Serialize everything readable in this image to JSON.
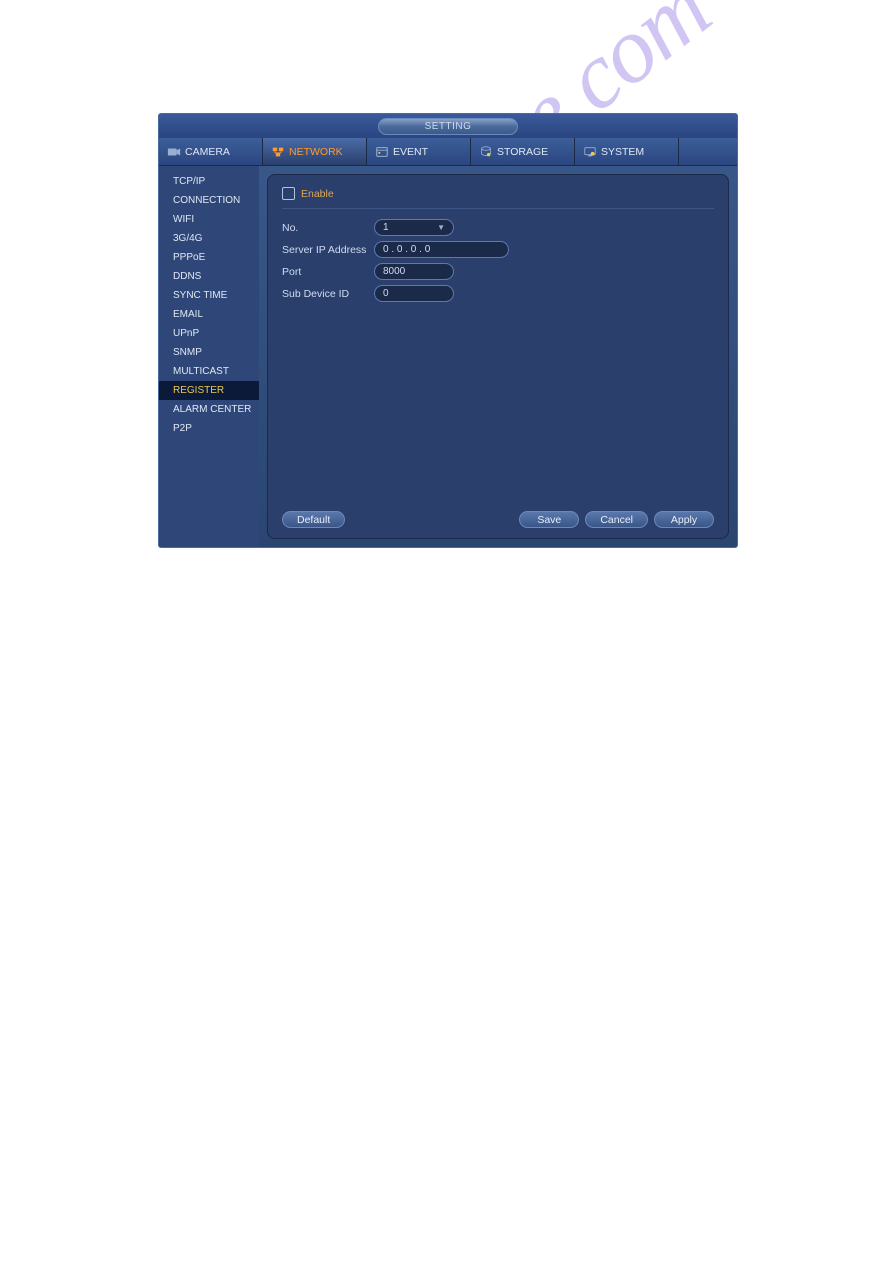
{
  "title": "SETTING",
  "tabs": [
    {
      "label": "CAMERA"
    },
    {
      "label": "NETWORK"
    },
    {
      "label": "EVENT"
    },
    {
      "label": "STORAGE"
    },
    {
      "label": "SYSTEM"
    }
  ],
  "sidebar": {
    "items": [
      {
        "label": "TCP/IP"
      },
      {
        "label": "CONNECTION"
      },
      {
        "label": "WIFI"
      },
      {
        "label": "3G/4G"
      },
      {
        "label": "PPPoE"
      },
      {
        "label": "DDNS"
      },
      {
        "label": "SYNC TIME"
      },
      {
        "label": "EMAIL"
      },
      {
        "label": "UPnP"
      },
      {
        "label": "SNMP"
      },
      {
        "label": "MULTICAST"
      },
      {
        "label": "REGISTER"
      },
      {
        "label": "ALARM CENTER"
      },
      {
        "label": "P2P"
      }
    ]
  },
  "form": {
    "enable_label": "Enable",
    "no_label": "No.",
    "no_value": "1",
    "server_ip_label": "Server IP Address",
    "server_ip_value": "0 . 0 . 0 . 0",
    "port_label": "Port",
    "port_value": "8000",
    "sub_device_label": "Sub Device ID",
    "sub_device_value": "0"
  },
  "buttons": {
    "default_label": "Default",
    "save_label": "Save",
    "cancel_label": "Cancel",
    "apply_label": "Apply"
  },
  "watermark": "manualshive.com"
}
